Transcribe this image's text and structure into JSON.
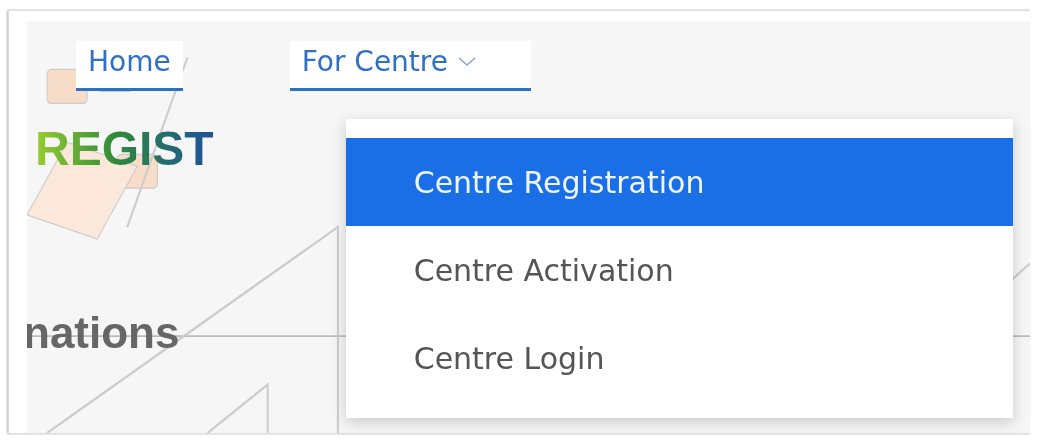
{
  "nav": [
    {
      "label": "Home",
      "kind": "link"
    },
    {
      "label": "For Centre",
      "kind": "menu",
      "expanded": true,
      "menu": [
        {
          "label": "Centre Registration",
          "selected": true
        },
        {
          "label": "Centre Activation",
          "selected": false
        },
        {
          "label": "Centre Login",
          "selected": false
        }
      ]
    }
  ],
  "banner": {
    "heading": "REGIST",
    "subheading": "nations"
  }
}
